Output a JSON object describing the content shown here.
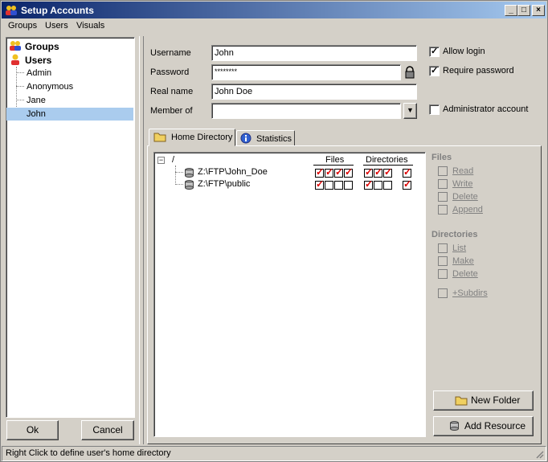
{
  "window": {
    "title": "Setup Accounts"
  },
  "menu": [
    "Groups",
    "Users",
    "Visuals"
  ],
  "tree": {
    "groups_label": "Groups",
    "users_label": "Users",
    "users": [
      "Admin",
      "Anonymous",
      "Jane",
      "John"
    ],
    "selected": "John"
  },
  "buttons": {
    "ok": "Ok",
    "cancel": "Cancel",
    "new_folder": "New Folder",
    "add_resource": "Add Resource"
  },
  "form": {
    "username_label": "Username",
    "username_value": "John",
    "password_label": "Password",
    "password_value": "********",
    "realname_label": "Real name",
    "realname_value": "John Doe",
    "member_label": "Member of",
    "member_value": "",
    "allow_login": "Allow login",
    "allow_login_checked": true,
    "require_password": "Require password",
    "require_password_checked": true,
    "admin_account": "Administrator account",
    "admin_account_checked": false
  },
  "tabs": [
    "Home Directory",
    "Statistics"
  ],
  "home_dir": {
    "root": "/",
    "files_header": "Files",
    "dirs_header": "Directories",
    "entries": [
      {
        "path": "Z:\\FTP\\John_Doe",
        "files": [
          true,
          true,
          true,
          true
        ],
        "dirs": [
          true,
          true,
          true
        ],
        "subdirs": true
      },
      {
        "path": "Z:\\FTP\\public",
        "files": [
          true,
          false,
          false,
          false
        ],
        "dirs": [
          true,
          false,
          false
        ],
        "subdirs": true
      }
    ]
  },
  "rights": {
    "files_heading": "Files",
    "file_items": [
      "Read",
      "Write",
      "Delete",
      "Append"
    ],
    "dirs_heading": "Directories",
    "dir_items": [
      "List",
      "Make",
      "Delete"
    ],
    "subdirs": "+Subdirs"
  },
  "status": "Right Click to define user's home directory",
  "colors": {
    "title_start": "#0a246a",
    "title_end": "#a6caf0",
    "face": "#d4d0c8",
    "selected": "#aaccee",
    "check_red": "#dd0000"
  }
}
